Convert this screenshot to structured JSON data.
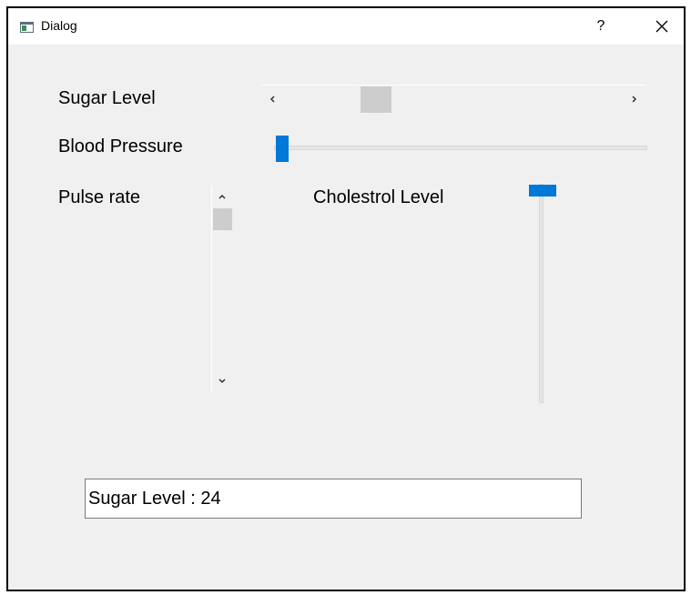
{
  "window": {
    "title": "Dialog",
    "help_label": "?",
    "border_color": "#000000",
    "background": "#f0f0f0"
  },
  "icons": {
    "app": "window-icon",
    "close": "close-icon",
    "left": "chevron-left-icon",
    "right": "chevron-right-icon",
    "up": "chevron-up-icon",
    "down": "chevron-down-icon"
  },
  "labels": {
    "sugar_level": "Sugar Level",
    "blood_pressure": "Blood Pressure",
    "pulse_rate": "Pulse rate",
    "cholestrol_level": "Cholestrol Level"
  },
  "controls": {
    "sugar_scrollbar_value": 0.27,
    "blood_pressure_slider_value": 0,
    "pulse_scrollbar_value": 0,
    "cholestrol_slider_value": 1
  },
  "result": {
    "text": "Sugar Level : 24"
  },
  "colors": {
    "accent": "#0078d7",
    "scroll_thumb": "#cdcdcd"
  }
}
